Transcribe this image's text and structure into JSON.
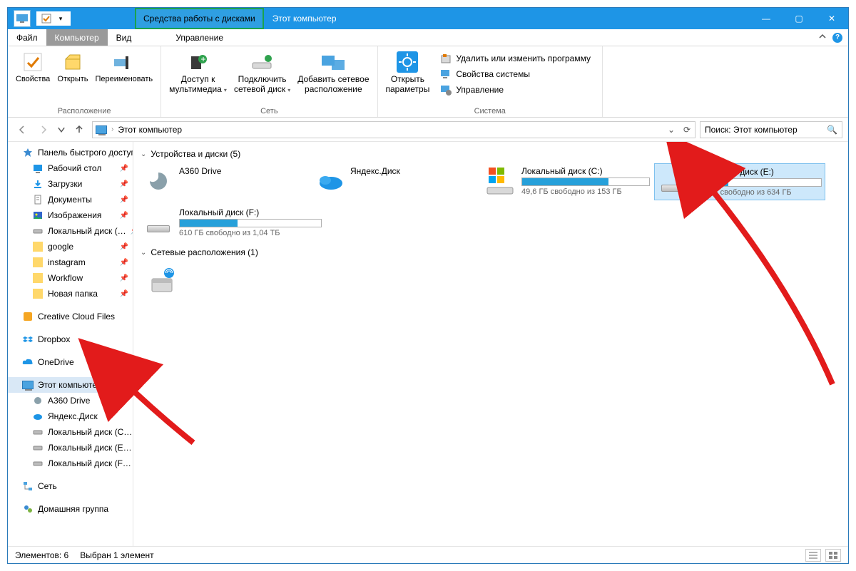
{
  "title": {
    "context_tab": "Средства работы с дисками",
    "window_title": "Этот компьютер"
  },
  "menutabs": {
    "file": "Файл",
    "computer": "Компьютер",
    "view": "Вид",
    "manage": "Управление"
  },
  "ribbon": {
    "group_location": "Расположение",
    "group_network": "Сеть",
    "group_system": "Система",
    "props": "Свойства",
    "open": "Открыть",
    "rename": "Переименовать",
    "media_l1": "Доступ к",
    "media_l2": "мультимедиа",
    "mapdrive_l1": "Подключить",
    "mapdrive_l2": "сетевой диск",
    "addnet_l1": "Добавить сетевое",
    "addnet_l2": "расположение",
    "settings_l1": "Открыть",
    "settings_l2": "параметры",
    "uninstall": "Удалить или изменить программу",
    "sysprops": "Свойства системы",
    "manage": "Управление"
  },
  "addr": {
    "breadcrumb": "Этот компьютер"
  },
  "search": {
    "placeholder": "Поиск: Этот компьютер"
  },
  "side": {
    "quick": "Панель быстрого доступа",
    "items": [
      {
        "k": "desktop",
        "t": "Рабочий стол",
        "pin": true
      },
      {
        "k": "downloads",
        "t": "Загрузки",
        "pin": true
      },
      {
        "k": "documents",
        "t": "Документы",
        "pin": true
      },
      {
        "k": "pictures",
        "t": "Изображения",
        "pin": true
      },
      {
        "k": "localdisk",
        "t": "Локальный диск (…",
        "pin": true
      },
      {
        "k": "google",
        "t": "google",
        "pin": true
      },
      {
        "k": "instagram",
        "t": "instagram",
        "pin": true
      },
      {
        "k": "workflow",
        "t": "Workflow",
        "pin": true
      },
      {
        "k": "newfolder",
        "t": "Новая папка",
        "pin": true
      }
    ],
    "ccf": "Creative Cloud Files",
    "dropbox": "Dropbox",
    "onedrive": "OneDrive",
    "thispc": "Этот компьютер",
    "pcsub": [
      {
        "k": "a360",
        "t": "A360 Drive"
      },
      {
        "k": "yd",
        "t": "Яндекс.Диск"
      },
      {
        "k": "lc",
        "t": "Локальный диск (C…"
      },
      {
        "k": "le",
        "t": "Локальный диск (E…"
      },
      {
        "k": "lf",
        "t": "Локальный диск (F…"
      }
    ],
    "net": "Сеть",
    "homegroup": "Домашняя группа"
  },
  "cats": {
    "devices": "Устройства и диски (5)",
    "netloc": "Сетевые расположения (1)"
  },
  "tiles": {
    "a360": "A360 Drive",
    "yadisk": "Яндекс.Диск",
    "c": {
      "name": "Локальный диск (C:)",
      "free": "49,6 ГБ свободно из 153 ГБ",
      "pct": 68
    },
    "e": {
      "name": "Локальный диск (E:)",
      "free": "465 ГБ свободно из 634 ГБ",
      "pct": 27
    },
    "f": {
      "name": "Локальный диск (F:)",
      "free": "610 ГБ свободно из 1,04 ТБ",
      "pct": 41
    }
  },
  "statusbar": {
    "count": "Элементов: 6",
    "sel": "Выбран 1 элемент"
  }
}
